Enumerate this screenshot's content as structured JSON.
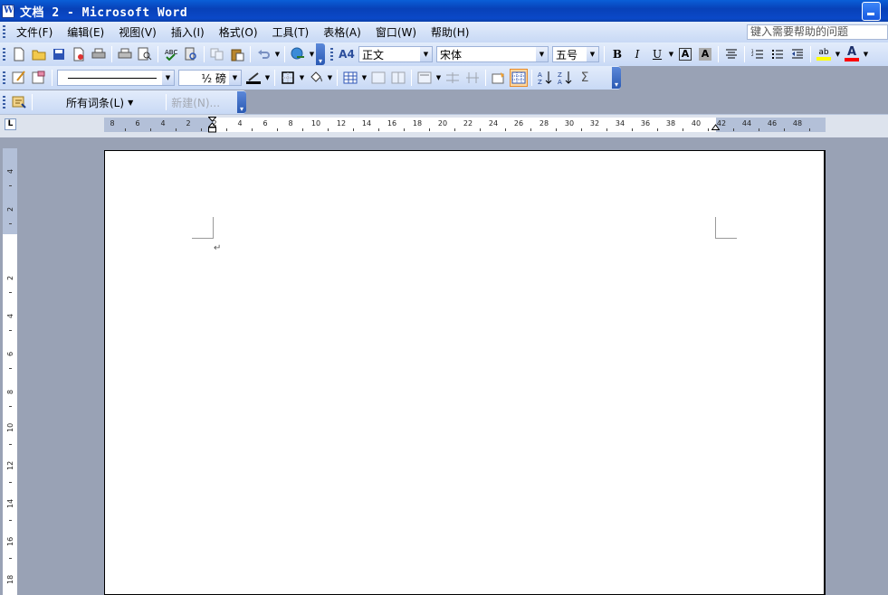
{
  "window": {
    "title": "文档 2 - Microsoft Word"
  },
  "menubar": {
    "items": [
      {
        "label": "文件(F)"
      },
      {
        "label": "编辑(E)"
      },
      {
        "label": "视图(V)"
      },
      {
        "label": "插入(I)"
      },
      {
        "label": "格式(O)"
      },
      {
        "label": "工具(T)"
      },
      {
        "label": "表格(A)"
      },
      {
        "label": "窗口(W)"
      },
      {
        "label": "帮助(H)"
      }
    ],
    "help_placeholder": "键入需要帮助的问题"
  },
  "formatting": {
    "style_value": "正文",
    "style_icon_label": "A4",
    "font_value": "宋体",
    "size_value": "五号",
    "bold": "B",
    "italic": "I",
    "underline": "U",
    "border_a": "A",
    "shade_a": "A",
    "font_color_a": "A",
    "highlight_label": "ab"
  },
  "tables_borders": {
    "line_weight": "½ 磅",
    "sum_symbol": "Σ"
  },
  "autotext": {
    "all_entries": "所有词条(L)",
    "new_button": "新建(N)..."
  },
  "ruler": {
    "tab_selector": "L",
    "horizontal_labels": [
      "8",
      "6",
      "4",
      "2",
      "2",
      "4",
      "6",
      "8",
      "10",
      "12",
      "14",
      "16",
      "18",
      "20",
      "22",
      "24",
      "26",
      "28",
      "30",
      "32",
      "34",
      "36",
      "38",
      "40",
      "42",
      "44",
      "46",
      "48"
    ],
    "vertical_labels": [
      "4",
      "2",
      "2",
      "4",
      "6",
      "8",
      "10",
      "12",
      "14",
      "16",
      "18"
    ]
  },
  "document": {
    "paragraph_mark": "↵"
  },
  "colors": {
    "title_bar": "#0a48c8",
    "toolbar_bg": "#d6e2f7",
    "workspace": "#99a2b5",
    "highlight_color": "#ffff00",
    "font_color": "#ff0000"
  }
}
